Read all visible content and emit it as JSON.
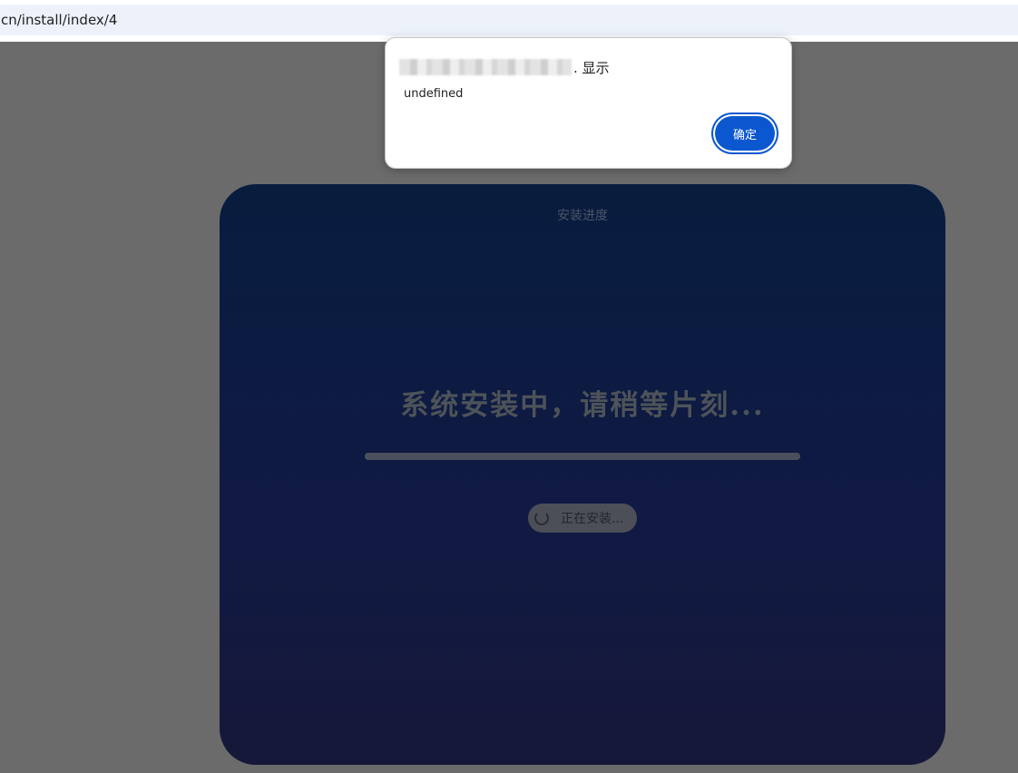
{
  "browser": {
    "url": "cn/install/index/4"
  },
  "card": {
    "title": "安装进度",
    "message": "系统安装中，请稍等片刻...",
    "progress_percent": 100,
    "status": "正在安装..."
  },
  "dialog": {
    "origin_suffix": ". 显示",
    "message": "undefined",
    "ok_label": "确定"
  },
  "colors": {
    "overlay": "#6b6b6b",
    "card_gradient_top": "#081c3e",
    "card_gradient_bottom": "#161839",
    "primary_button": "#0b57d0"
  }
}
